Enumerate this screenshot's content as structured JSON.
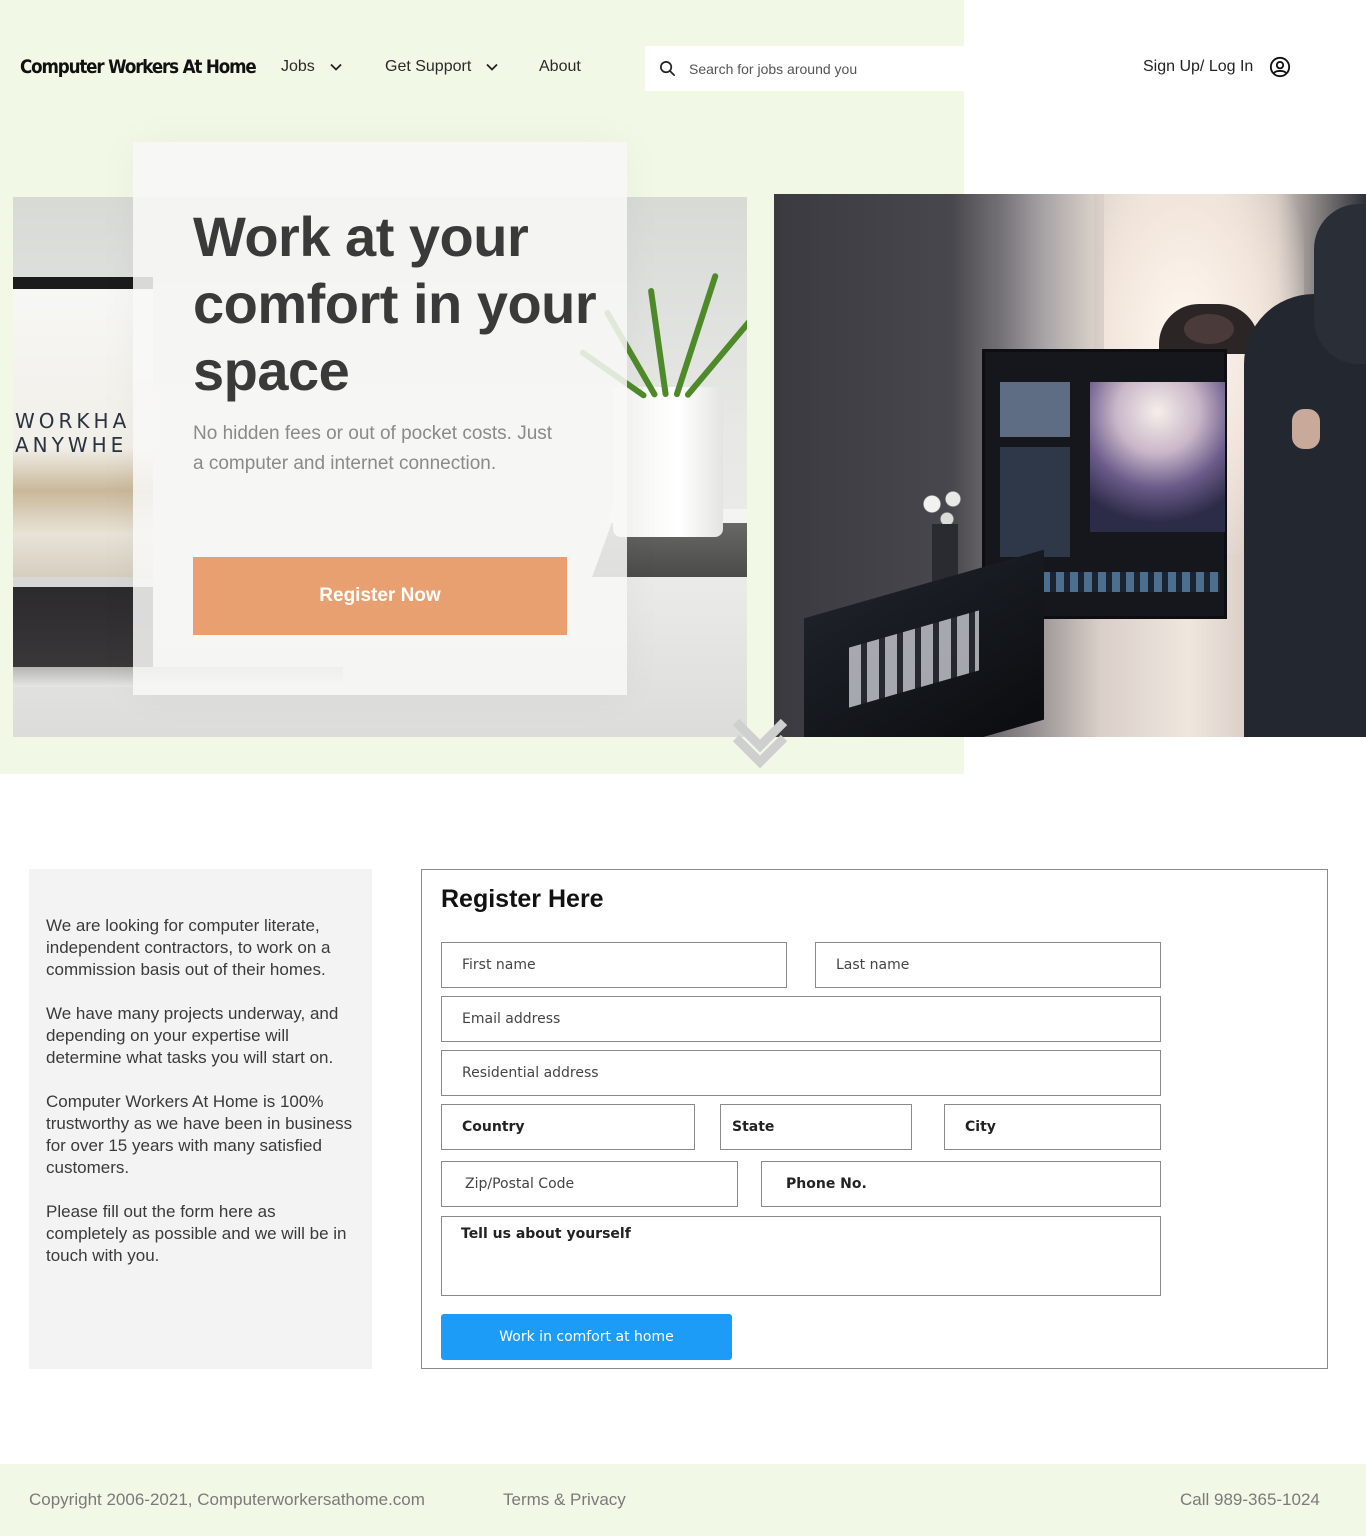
{
  "header": {
    "brand": "Computer Workers At Home",
    "nav": [
      {
        "label": "Jobs",
        "has_dropdown": true
      },
      {
        "label": "Get Support",
        "has_dropdown": true
      },
      {
        "label": "About",
        "has_dropdown": false
      }
    ],
    "search_placeholder": "Search for jobs around you",
    "search_icon": "search-icon",
    "signup_label": "Sign Up/ Log In",
    "account_icon": "user-circle-icon"
  },
  "hero": {
    "title": "Work at your comfort in your space",
    "subtitle": "No hidden fees or out of pocket costs. Just a computer and internet connection.",
    "cta_label": "Register Now",
    "laptop_text_line1": "WORKHA",
    "laptop_text_line2": "ANYWHE",
    "scroll_icon": "double-chevron-down-icon"
  },
  "info": {
    "paragraphs": [
      "We are looking for computer literate, independent contractors, to work on a commission basis out of their homes.",
      "We have many projects underway, and depending on your expertise will determine what tasks you will start on.",
      "Computer Workers At Home is 100% trustworthy as we have been in business for over 15 years with many satisfied customers.",
      "Please fill out the form here as completely as possible and we will be in touch with you."
    ]
  },
  "form": {
    "title": "Register Here",
    "first_name_placeholder": "First name",
    "last_name_placeholder": "Last name",
    "email_placeholder": "Email address",
    "address_placeholder": "Residential address",
    "country_label": "Country",
    "state_label": "State",
    "city_label": "City",
    "zip_placeholder": "Zip/Postal Code",
    "phone_label": "Phone No.",
    "about_label": "Tell us about yourself",
    "submit_label": "Work in comfort at home"
  },
  "footer": {
    "copyright": "Copyright 2006-2021, Computerworkersathome.com",
    "terms": "Terms & Privacy",
    "phone": "Call 989-365-1024"
  },
  "colors": {
    "hero_bg": "#f1f8e6",
    "cta_orange": "#e8a070",
    "submit_blue": "#1c9cf6",
    "info_panel": "#f3f3f3"
  }
}
